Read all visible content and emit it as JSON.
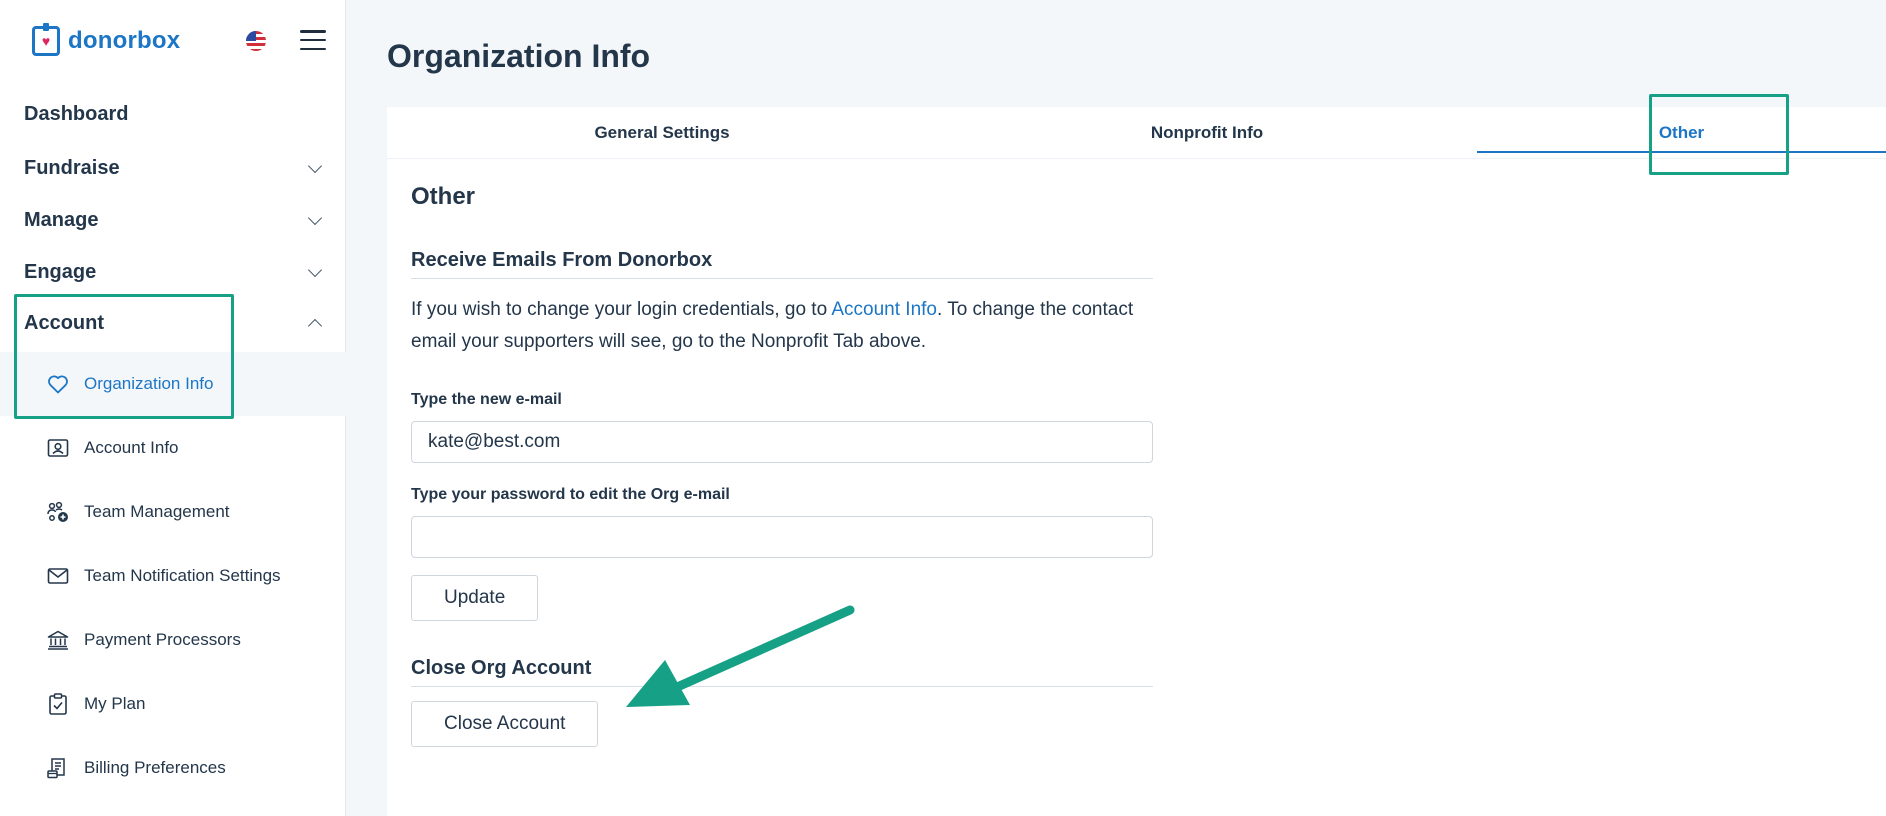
{
  "brand": {
    "name": "donorbox"
  },
  "sidebar": {
    "nav": [
      {
        "label": "Dashboard"
      },
      {
        "label": "Fundraise"
      },
      {
        "label": "Manage"
      },
      {
        "label": "Engage"
      },
      {
        "label": "Account"
      }
    ],
    "account_items": [
      {
        "label": "Organization Info",
        "icon": "heart-icon"
      },
      {
        "label": "Account Info",
        "icon": "id-card-icon"
      },
      {
        "label": "Team Management",
        "icon": "team-icon"
      },
      {
        "label": "Team Notification Settings",
        "icon": "envelope-icon"
      },
      {
        "label": "Payment Processors",
        "icon": "bank-icon"
      },
      {
        "label": "My Plan",
        "icon": "clipboard-check-icon"
      },
      {
        "label": "Billing Preferences",
        "icon": "billing-icon"
      }
    ]
  },
  "main": {
    "title": "Organization Info",
    "tabs": [
      {
        "label": "General Settings"
      },
      {
        "label": "Nonprofit Info"
      },
      {
        "label": "Other"
      }
    ],
    "section_title": "Other",
    "emails": {
      "heading": "Receive Emails From Donorbox",
      "para_prefix": "If you wish to change your login credentials, go to ",
      "para_link": "Account Info",
      "para_suffix": ". To change the contact email your supporters will see, go to the Nonprofit Tab above.",
      "email_label": "Type the new e-mail",
      "email_value": "kate@best.com",
      "password_label": "Type your password to edit the Org e-mail",
      "password_value": "",
      "update_label": "Update"
    },
    "close": {
      "heading": "Close Org Account",
      "button_label": "Close Account"
    }
  },
  "colors": {
    "accent": "#1c76c5",
    "highlight": "#16a085",
    "text": "#23364a"
  }
}
